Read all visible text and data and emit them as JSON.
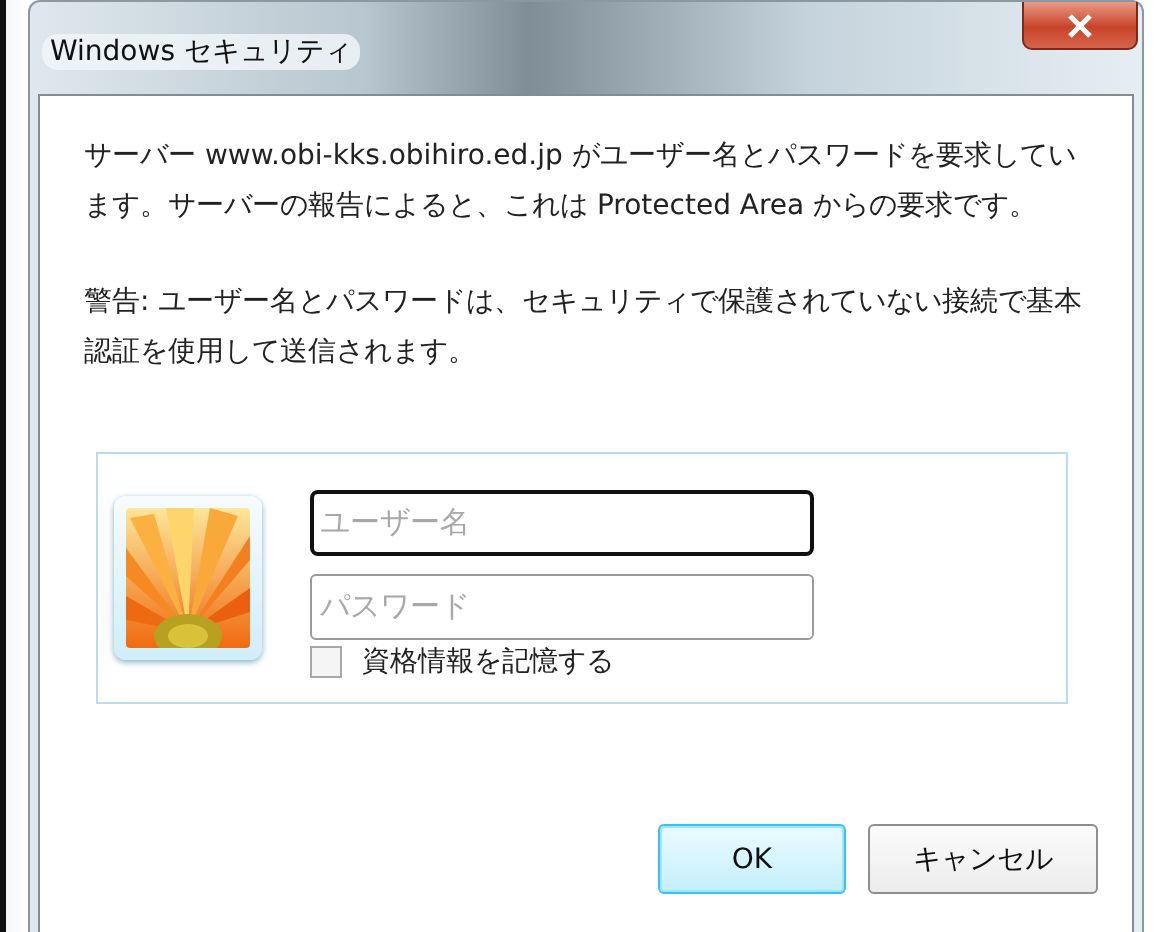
{
  "window": {
    "title": "Windows セキュリティ"
  },
  "message": "サーバー www.obi-kks.obihiro.ed.jp がユーザー名とパスワードを要求しています。サーバーの報告によると、これは Protected Area からの要求です。",
  "warning": "警告: ユーザー名とパスワードは、セキュリティで保護されていない接続で基本認証を使用して送信されます。",
  "credentials": {
    "username": {
      "placeholder": "ユーザー名",
      "focused": true
    },
    "password": {
      "placeholder": "パスワード"
    },
    "remember": {
      "label": "資格情報を記憶する",
      "checked": false
    }
  },
  "buttons": [
    {
      "label": "OK",
      "default": true
    },
    {
      "label": "キャンセル",
      "default": false
    }
  ]
}
